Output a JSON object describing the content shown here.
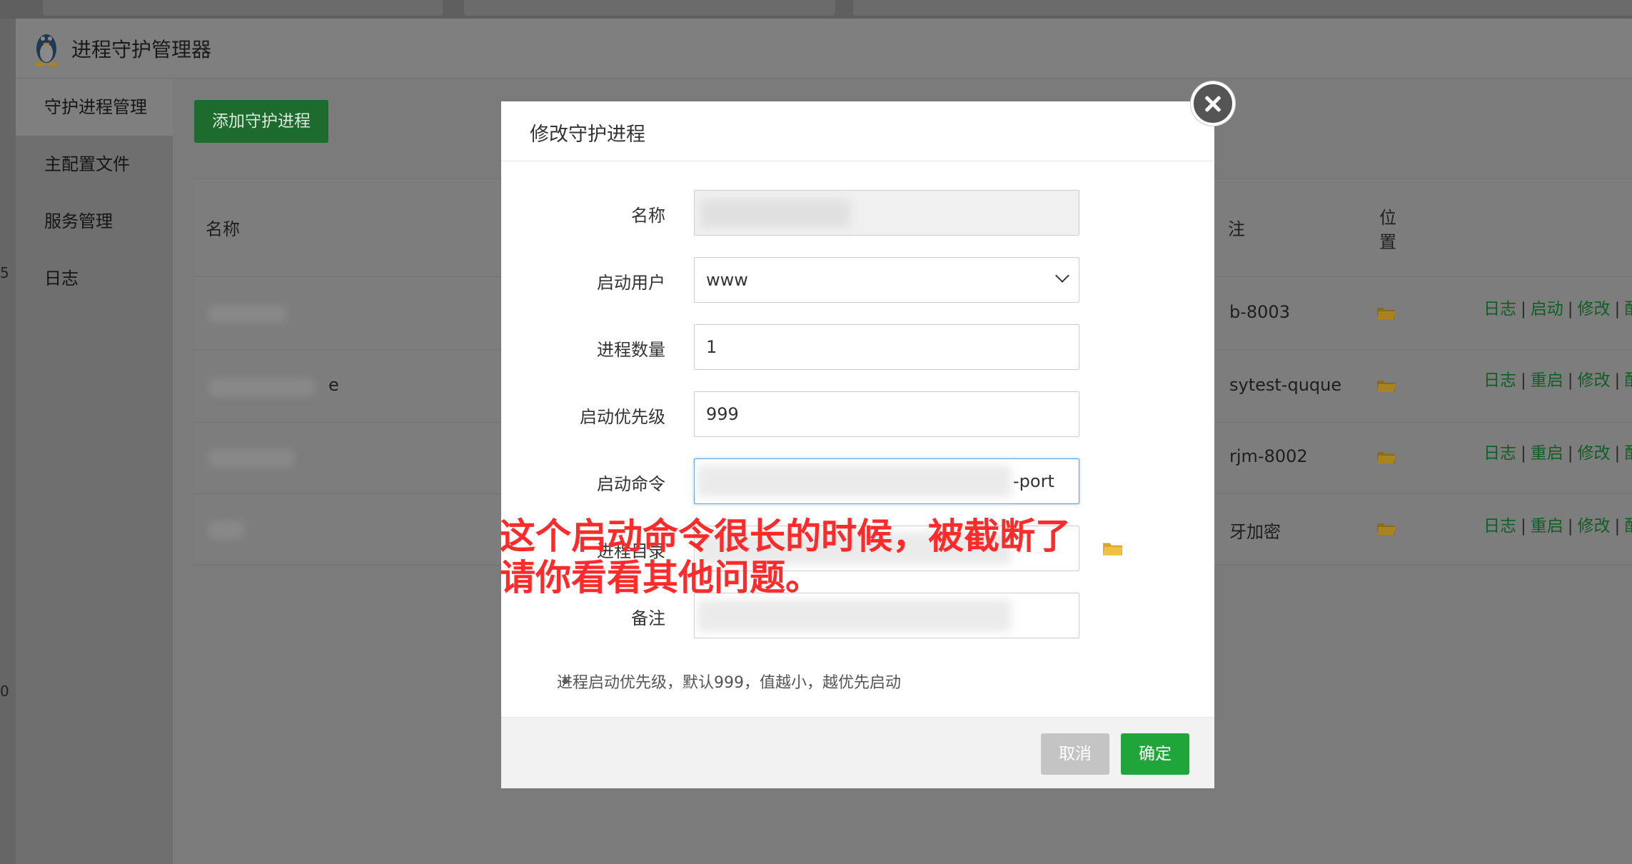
{
  "app": {
    "title": "进程守护管理器",
    "logo_icon": "linux-penguin-icon"
  },
  "sidebar": {
    "items": [
      {
        "label": "守护进程管理",
        "active": true
      },
      {
        "label": "主配置文件",
        "active": false
      },
      {
        "label": "服务管理",
        "active": false
      },
      {
        "label": "日志",
        "active": false
      }
    ]
  },
  "edge_numbers": [
    "5",
    "0"
  ],
  "toolbar": {
    "add_label": "添加守护进程"
  },
  "table": {
    "headers": {
      "name": "名称",
      "note": "注",
      "location_line1": "位",
      "location_line2": "置"
    },
    "rows": [
      {
        "name_suffix": "",
        "note": "b-8003",
        "ops": [
          "日志",
          "启动",
          "修改",
          "配置文"
        ]
      },
      {
        "name_suffix": "e",
        "note": "sytest-quque",
        "ops": [
          "日志",
          "重启",
          "修改",
          "配置文"
        ]
      },
      {
        "name_suffix": "",
        "note": "rjm-8002",
        "ops": [
          "日志",
          "重启",
          "修改",
          "配置文"
        ]
      },
      {
        "name_suffix": "",
        "note": "牙加密",
        "ops": [
          "日志",
          "重启",
          "修改",
          "配置文"
        ]
      }
    ]
  },
  "modal": {
    "title": "修改守护进程",
    "fields": {
      "name_label": "名称",
      "user_label": "启动用户",
      "user_value": "www",
      "count_label": "进程数量",
      "count_value": "1",
      "priority_label": "启动优先级",
      "priority_value": "999",
      "command_label": "启动命令",
      "command_value_visible": "-port",
      "dir_label": "进程目录",
      "note_label": "备注"
    },
    "hint": "进程启动优先级，默认999，值越小，越优先启动",
    "cancel_label": "取消",
    "ok_label": "确定"
  },
  "annotation": {
    "line1": "这个启动命令很长的时候，被截断了",
    "line2": "请你看看其他问题。",
    "color": "#ff2b2b"
  },
  "colors": {
    "accent_green": "#20a53a",
    "link_green": "#0f5e24"
  }
}
